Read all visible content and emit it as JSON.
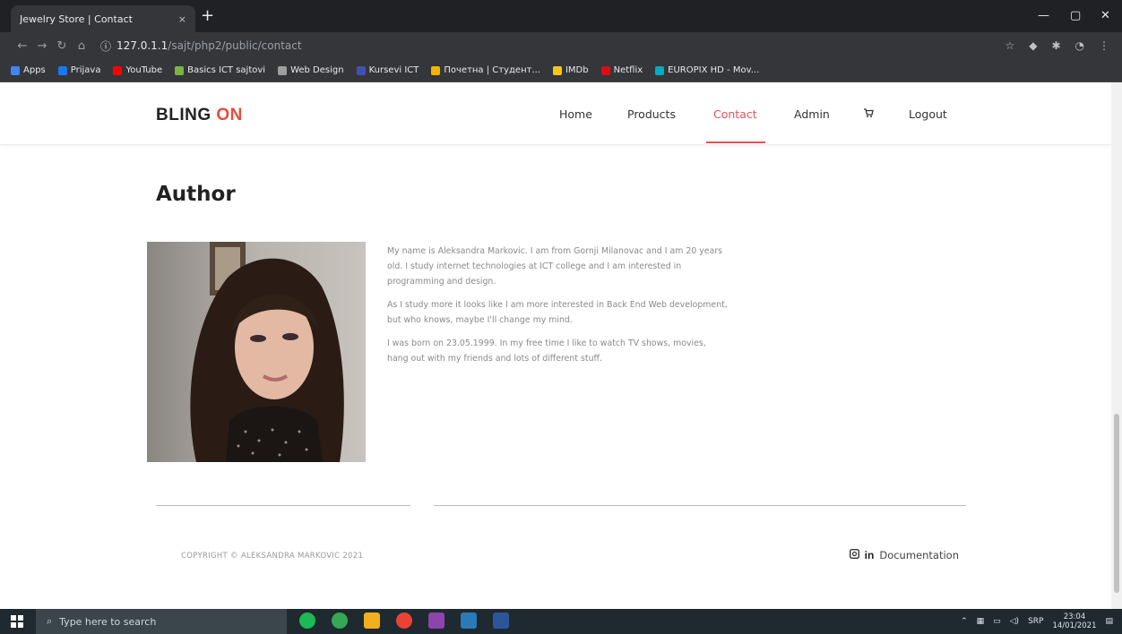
{
  "browser": {
    "tab_title": "Jewelry Store | Contact",
    "tab_close": "×",
    "new_tab": "+",
    "url_host": "127.0.1.1",
    "url_path": "/sajt/php2/public/contact",
    "bookmarks": [
      {
        "label": "Apps",
        "color": "#4285f4"
      },
      {
        "label": "Prijava",
        "color": "#1877f2"
      },
      {
        "label": "YouTube",
        "color": "#ff0000"
      },
      {
        "label": "Basics ICT sajtovi",
        "color": "#7cb342"
      },
      {
        "label": "Web Design",
        "color": "#9e9e9e"
      },
      {
        "label": "Kursevi ICT",
        "color": "#3f51b5"
      },
      {
        "label": "Почетна | Студент...",
        "color": "#f4b400"
      },
      {
        "label": "IMDb",
        "color": "#f5c518"
      },
      {
        "label": "Netflix",
        "color": "#e50914"
      },
      {
        "label": "EUROPIX HD - Mov...",
        "color": "#00acc1"
      }
    ]
  },
  "site": {
    "logo_main": "BLING ",
    "logo_accent": "ON",
    "menu": [
      {
        "label": "Home",
        "active": false
      },
      {
        "label": "Products",
        "active": false
      },
      {
        "label": "Contact",
        "active": true
      },
      {
        "label": "Admin",
        "active": false
      },
      {
        "label": "cart-icon",
        "active": false
      },
      {
        "label": "Logout",
        "active": false
      }
    ],
    "cart_glyph": "🛒",
    "heading": "Author",
    "bio": [
      "My name is Aleksandra Markovic. I am from Gornji Milanovac and I am 20 years old. I study internet technologies at ICT college and I am interested in programming and design.",
      "As I study more it looks like I am more interested in Back End Web development, but who knows, maybe I'll change my mind.",
      "I was born on 23.05.1999. In my free time I like to watch TV shows, movies, hang out with my friends and lots of different stuff."
    ],
    "copyright": "COPYRIGHT © ALEKSANDRA MARKOVIC 2021",
    "linkedin_label": "in",
    "documentation_label": "Documentation",
    "accent_color": "#e8505b"
  },
  "taskbar": {
    "search_placeholder": "Type here to search",
    "language": "SRP",
    "time": "23:04",
    "date": "14/01/2021"
  }
}
